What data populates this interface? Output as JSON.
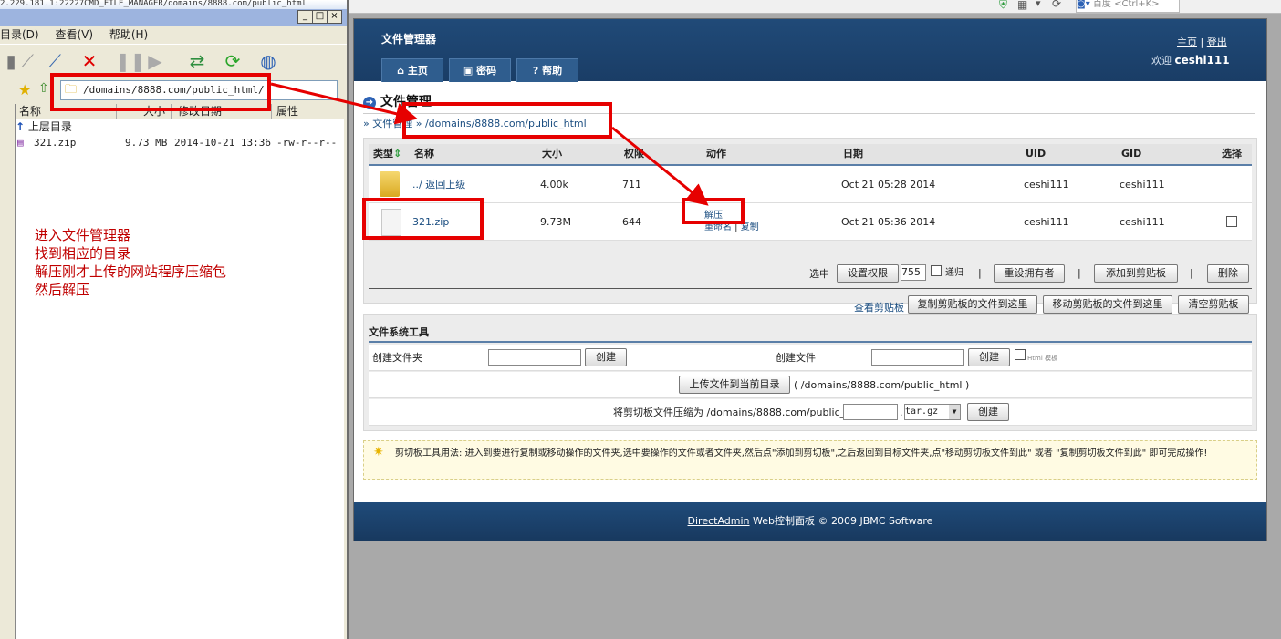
{
  "ftp": {
    "title": "2.229.181.1:22227CMD_FILE_MANAGER/domains/8888.com/public_html",
    "menu": [
      "目录(D)",
      "查看(V)",
      "帮助(H)"
    ],
    "address": "/domains/8888.com/public_html/",
    "columns": [
      "名称",
      "大小",
      "修改日期",
      "属性"
    ],
    "parent_label": "上层目录",
    "files": [
      {
        "name": "321.zip",
        "size": "9.73 MB",
        "date": "2014-10-21 13:36",
        "attr": "-rw-r--r--"
      }
    ]
  },
  "browser": {
    "search_hint": "百度 <Ctrl+K>"
  },
  "annotation": {
    "lines": [
      "进入文件管理器",
      "找到相应的目录",
      "解压刚才上传的网站程序压缩包",
      "然后解压"
    ]
  },
  "da": {
    "header_title": "文件管理器",
    "links": {
      "home": "主页",
      "sep": "|",
      "logout": "登出"
    },
    "welcome_prefix": "欢迎",
    "username": "ceshi111",
    "tabs": [
      "主页",
      "密码",
      "帮助"
    ],
    "page_title": "文件管理",
    "crumb_root": "文件管理",
    "crumb_path": "/domains/8888.com/public_html",
    "table": {
      "headers": [
        "类型",
        "名称",
        "大小",
        "权限",
        "动作",
        "日期",
        "UID",
        "GID",
        "选择"
      ],
      "rows": [
        {
          "name": "../ 返回上级",
          "size": "4.00k",
          "perm": "711",
          "actions": [],
          "date": "Oct 21 05:28 2014",
          "uid": "ceshi111",
          "gid": "ceshi111",
          "kind": "folder"
        },
        {
          "name": "321.zip",
          "size": "9.73M",
          "perm": "644",
          "actions": [
            "解压",
            "重命名",
            "复制"
          ],
          "date": "Oct 21 05:36 2014",
          "uid": "ceshi111",
          "gid": "ceshi111",
          "kind": "file"
        }
      ]
    },
    "selection": {
      "label": "选中",
      "set_perm": "设置权限",
      "perm_value": "755",
      "recursive": "递归",
      "reset_owner": "重设拥有者",
      "add_clipboard": "添加到剪贴板",
      "delete": "删除",
      "view_clipboard": "查看剪贴板",
      "copy_here": "复制剪贴板的文件到这里",
      "move_here": "移动剪贴板的文件到这里",
      "clear_clipboard": "清空剪贴板"
    },
    "tools": {
      "title": "文件系统工具",
      "create_folder": "创建文件夹",
      "create_file": "创建文件",
      "create_btn": "创建",
      "html_template": "Html 模板",
      "upload_btn": "上传文件到当前目录",
      "upload_path": "( /domains/8888.com/public_html )",
      "compress_label": "将剪切板文件压缩为 /domains/8888.com/public_html",
      "compress_ext": "tar.gz"
    },
    "hint": "剪切板工具用法: 进入到要进行复制或移动操作的文件夹,选中要操作的文件或者文件夹,然后点\"添加到剪切板\",之后返回到目标文件夹,点\"移动剪切板文件到此\" 或者 \"复制剪切板文件到此\" 即可完成操作!",
    "footer": {
      "link": "DirectAdmin",
      "text": " Web控制面板 © 2009 JBMC Software"
    }
  }
}
